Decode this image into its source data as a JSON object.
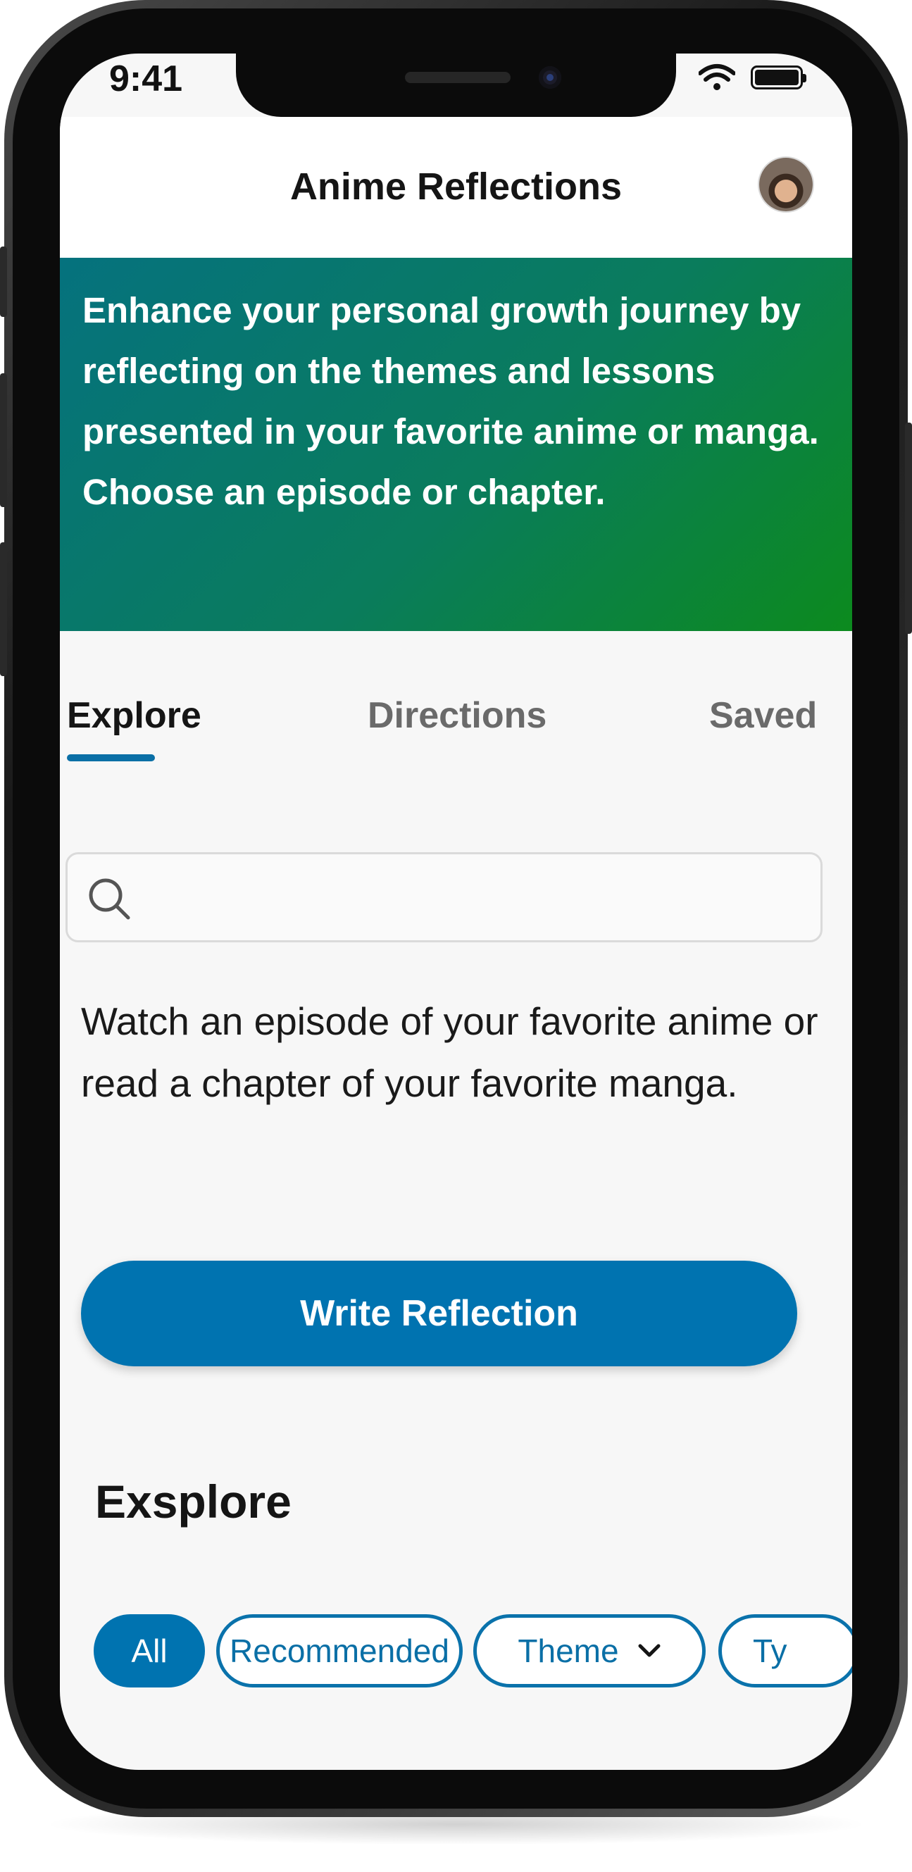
{
  "status_bar": {
    "time": "9:41",
    "icons": [
      "wifi-icon",
      "battery-icon"
    ]
  },
  "header": {
    "title": "Anime Reflections",
    "avatar": "user-avatar"
  },
  "banner": {
    "text": "Enhance your personal growth journey by reflecting on the themes and lessons presented in your favorite anime or manga. Choose an episode or chapter."
  },
  "tabs": [
    {
      "label": "Explore",
      "active": true
    },
    {
      "label": "Directions",
      "active": false
    },
    {
      "label": "Saved",
      "active": false
    }
  ],
  "search": {
    "icon": "search-icon",
    "placeholder": ""
  },
  "instructions": "Watch an episode of your favorite anime or read a chapter of your favorite manga.",
  "cta": {
    "label": "Write Reflection"
  },
  "section": {
    "title": "Exsplore"
  },
  "filters": [
    {
      "label": "All",
      "selected": true
    },
    {
      "label": "Recommended",
      "selected": false
    },
    {
      "label": "Theme",
      "selected": false,
      "icon": "chevron-down-icon"
    },
    {
      "label": "Ty",
      "selected": false
    }
  ],
  "colors": {
    "accent": "#0073b0",
    "banner_start": "#05727e",
    "banner_end": "#0c8a1e",
    "background": "#f7f7f7"
  }
}
